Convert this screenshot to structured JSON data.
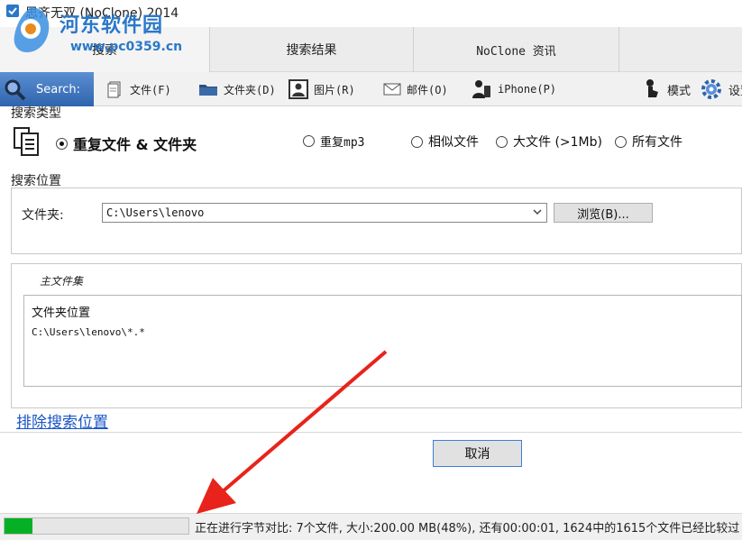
{
  "window": {
    "title": "思齐无双 (NoClone) 2014"
  },
  "watermark": {
    "name": "河东软件园",
    "url": "www.pc0359.cn"
  },
  "tabs": [
    {
      "label": "搜索"
    },
    {
      "label": "搜索结果"
    },
    {
      "label": "NoClone 资讯"
    }
  ],
  "toolbar": {
    "search_label": "Search:",
    "items": [
      {
        "label": "文件(F)",
        "icon": "file-icon"
      },
      {
        "label": "文件夹(D)",
        "icon": "folder-icon"
      },
      {
        "label": "图片(R)",
        "icon": "picture-icon"
      },
      {
        "label": "邮件(O)",
        "icon": "mail-icon"
      },
      {
        "label": "iPhone(P)",
        "icon": "phone-icon"
      }
    ],
    "mode_label": "模式",
    "settings_label": "设置"
  },
  "search_type": {
    "heading": "搜索类型",
    "options": [
      {
        "label": "重复文件 & 文件夹",
        "selected": true
      },
      {
        "label": "重复mp3",
        "selected": false
      },
      {
        "label": "相似文件",
        "selected": false
      },
      {
        "label": "大文件 (>1Mb)",
        "selected": false
      },
      {
        "label": "所有文件",
        "selected": false
      }
    ]
  },
  "search_location": {
    "heading": "搜索位置",
    "folder_label": "文件夹:",
    "folder_value": "C:\\Users\\lenovo",
    "browse_label": "浏览(B)..."
  },
  "main_set": {
    "heading": "主文件集",
    "column_header": "文件夹位置",
    "rows": [
      "C:\\Users\\lenovo\\*.*"
    ]
  },
  "exclude_link": "排除搜索位置",
  "cancel_label": "取消",
  "status": {
    "progress": 0.15,
    "text": "正在进行字节对比: 7个文件, 大小:200.00 MB(48%), 还有00:00:01, 1624中的1615个文件已经比较过"
  },
  "colors": {
    "accent": "#2f63ad",
    "progress": "#06b025",
    "link": "#1a55c7",
    "annotation_arrow": "#e8231b"
  }
}
